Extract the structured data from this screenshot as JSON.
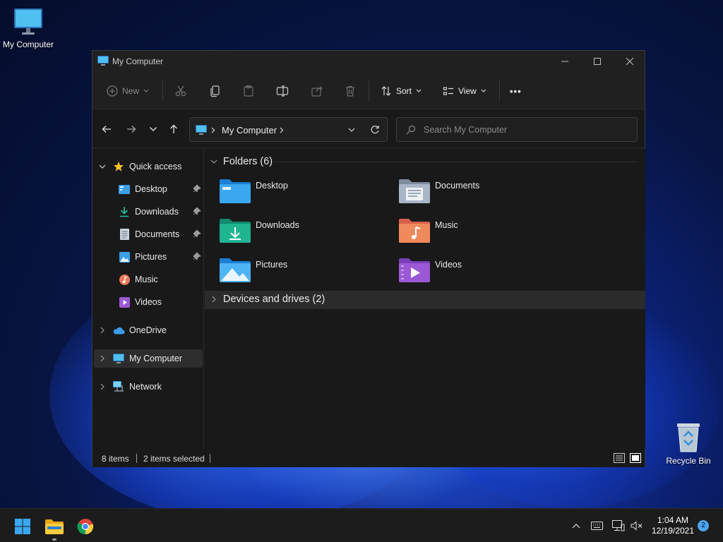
{
  "desktop": {
    "icons": [
      {
        "label": "My Computer",
        "icon": "monitor-icon"
      },
      {
        "label": "Recycle Bin",
        "icon": "recycle-bin-icon"
      }
    ]
  },
  "window": {
    "title": "My Computer",
    "controls": {
      "minimize": "minimize-icon",
      "maximize": "maximize-icon",
      "close": "close-icon"
    }
  },
  "toolbar": {
    "new_label": "New",
    "sort_label": "Sort",
    "view_label": "View",
    "more_label": "•••",
    "icons": [
      "cut-icon",
      "copy-icon",
      "paste-icon",
      "rename-icon",
      "share-icon",
      "delete-icon"
    ]
  },
  "navigation": {
    "address_crumb": "My Computer",
    "search_placeholder": "Search My Computer"
  },
  "sidebar": {
    "quick_access": "Quick access",
    "items": [
      {
        "label": "Desktop",
        "pinned": true
      },
      {
        "label": "Downloads",
        "pinned": true
      },
      {
        "label": "Documents",
        "pinned": true
      },
      {
        "label": "Pictures",
        "pinned": true
      },
      {
        "label": "Music",
        "pinned": false
      },
      {
        "label": "Videos",
        "pinned": false
      }
    ],
    "onedrive": "OneDrive",
    "my_computer": "My Computer",
    "network": "Network"
  },
  "content": {
    "folders_header": "Folders (6)",
    "folders": [
      {
        "name": "Desktop",
        "color": "#3aa8f0"
      },
      {
        "name": "Documents",
        "color": "#a9b6c8"
      },
      {
        "name": "Downloads",
        "color": "#1fb58f"
      },
      {
        "name": "Music",
        "color": "#f08a5d"
      },
      {
        "name": "Pictures",
        "color": "#4fb4f5"
      },
      {
        "name": "Videos",
        "color": "#9b59d6"
      }
    ],
    "devices_header": "Devices and drives (2)"
  },
  "status": {
    "items": "8 items",
    "selected": "2 items selected"
  },
  "taskbar": {
    "time": "1:04 AM",
    "date": "12/19/2021",
    "notifications": "2",
    "apps": [
      "windows-start-icon",
      "file-explorer-icon",
      "chrome-icon"
    ]
  }
}
